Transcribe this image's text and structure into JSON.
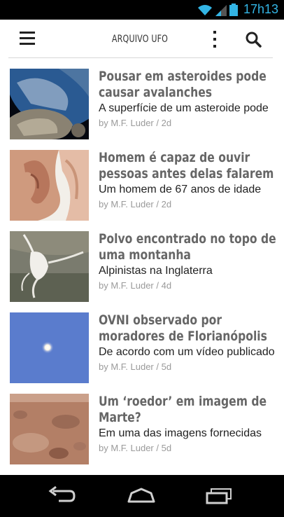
{
  "status_bar": {
    "time": "17h13"
  },
  "app_bar": {
    "title": "ARQUIVO UFO"
  },
  "articles": [
    {
      "title": "Pousar em asteroides pode causar avalanches",
      "subtitle": "A superfície de um asteroide pode",
      "meta": "by M.F. Luder / 2d"
    },
    {
      "title": "Homem é capaz de ouvir pessoas antes delas falarem",
      "subtitle": "Um homem de 67 anos de idade",
      "meta": "by M.F. Luder / 2d"
    },
    {
      "title": "Polvo encontrado no topo de uma montanha",
      "subtitle": "Alpinistas na Inglaterra",
      "meta": "by M.F. Luder / 4d"
    },
    {
      "title": "OVNI observado por moradores de Florianópolis",
      "subtitle": "De acordo com um vídeo publicado",
      "meta": "by M.F. Luder / 5d"
    },
    {
      "title": "Um ‘roedor’ em imagem de Marte?",
      "subtitle": "Em uma das imagens fornecidas",
      "meta": "by M.F. Luder / 5d"
    }
  ]
}
